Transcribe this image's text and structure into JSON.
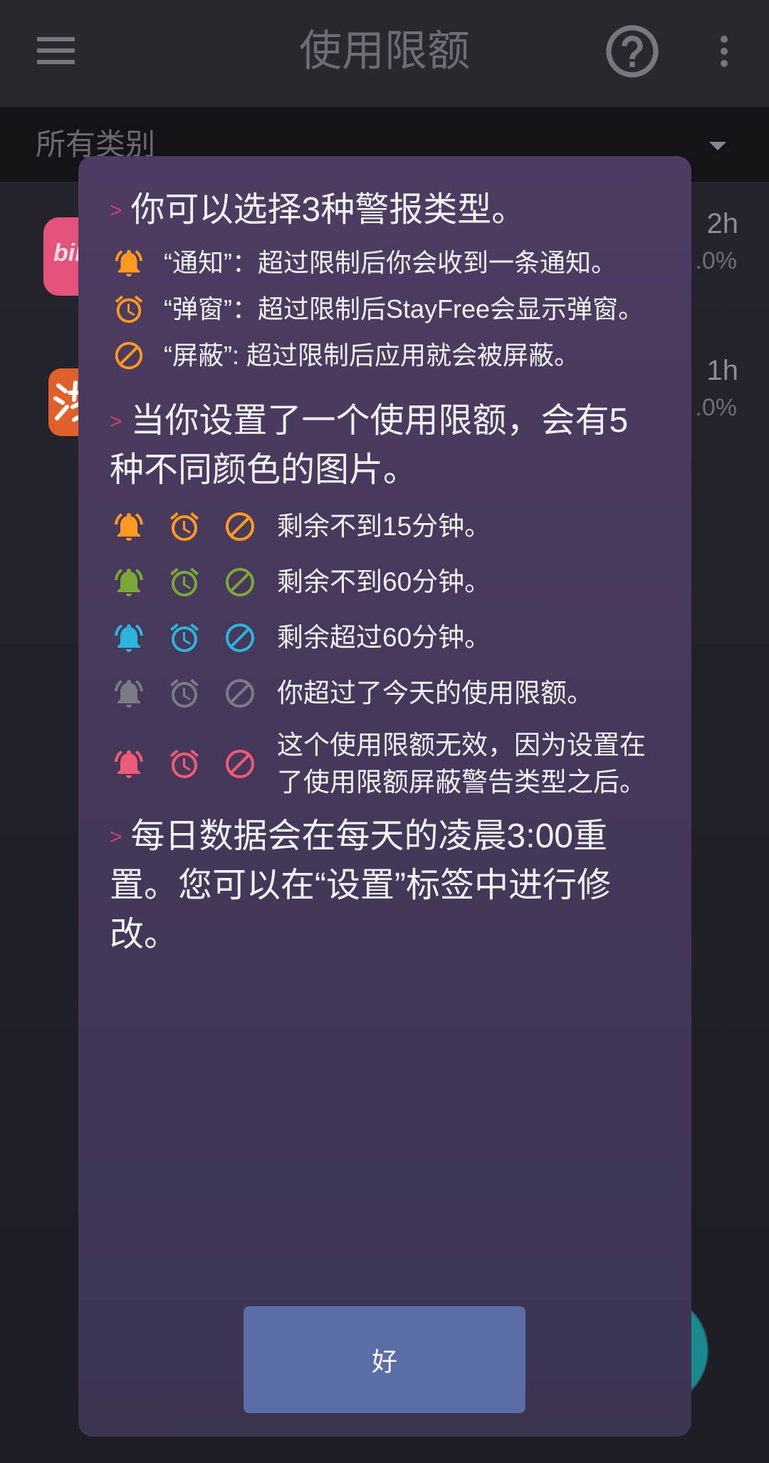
{
  "app_bar": {
    "title": "使用限额",
    "menu_icon": "menu-icon",
    "help_icon": "help-circle-icon",
    "more_icon": "more-vert-icon"
  },
  "category_filter": {
    "selected": "所有类别",
    "icon": "dropdown-arrow-icon"
  },
  "app_list": [
    {
      "logo_text": "bili",
      "logo_color": "#e5527c",
      "duration": "2h",
      "percent": ".0%"
    },
    {
      "logo_color": "#e0602c",
      "duration": "1h",
      "percent": ".0%"
    }
  ],
  "dialog": {
    "marker": ">",
    "alert_types": {
      "heading": "你可以选择3种警报类型。",
      "items": [
        {
          "icon": "bell-icon",
          "text": "“通知”：超过限制后你会收到一条通知。"
        },
        {
          "icon": "alarm-icon",
          "text": "“弹窗”：超过限制后StayFree会显示弹窗。"
        },
        {
          "icon": "block-icon",
          "text": "“屏蔽”: 超过限制后应用就会被屏蔽。"
        }
      ]
    },
    "color_legend": {
      "heading": "当你设置了一个使用限额，会有5种不同颜色的图片。",
      "items": [
        {
          "color": "#ff9a1f",
          "text": "剩余不到15分钟。"
        },
        {
          "color": "#79a838",
          "text": "剩余不到60分钟。"
        },
        {
          "color": "#2db4dc",
          "text": "剩余超过60分钟。"
        },
        {
          "color": "#7c7b84",
          "text": "你超过了今天的使用限额。"
        },
        {
          "color": "#ef5a75",
          "text": "这个使用限额无效，因为设置在了使用限额屏蔽警告类型之后。"
        }
      ]
    },
    "reset_note": {
      "heading": "每日数据会在每天的凌晨3:00重置。您可以在“设置”标签中进行修改。"
    },
    "ok_button": "好"
  },
  "colors": {
    "marker": "#d2406c",
    "alert_icon": "#ff9a1f",
    "button_bg": "#5a6da6",
    "fab": "#1b8a90"
  }
}
